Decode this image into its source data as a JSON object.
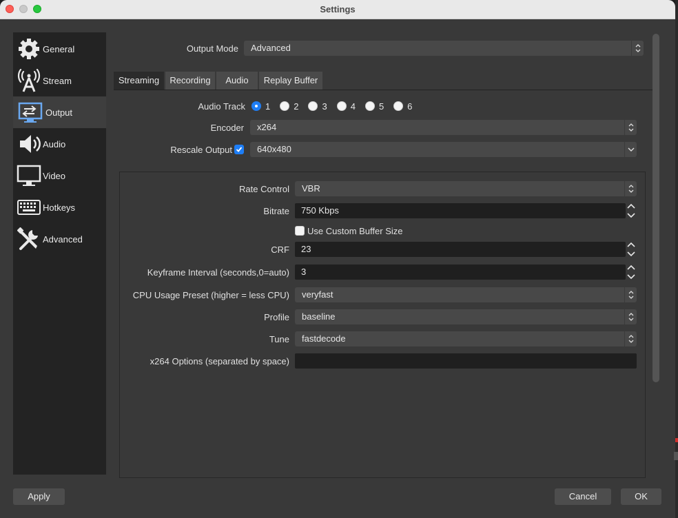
{
  "window": {
    "title": "Settings"
  },
  "sidebar": {
    "items": [
      {
        "label": "General",
        "icon": "gear-icon"
      },
      {
        "label": "Stream",
        "icon": "broadcast-antenna-icon"
      },
      {
        "label": "Output",
        "icon": "monitor-output-icon",
        "active": true
      },
      {
        "label": "Audio",
        "icon": "speaker-icon"
      },
      {
        "label": "Video",
        "icon": "monitor-icon"
      },
      {
        "label": "Hotkeys",
        "icon": "keyboard-icon"
      },
      {
        "label": "Advanced",
        "icon": "tools-icon"
      }
    ]
  },
  "output": {
    "mode_label": "Output Mode",
    "mode_value": "Advanced",
    "tabs": [
      "Streaming",
      "Recording",
      "Audio",
      "Replay Buffer"
    ],
    "active_tab": "Streaming",
    "audio_track_label": "Audio Track",
    "audio_tracks": [
      "1",
      "2",
      "3",
      "4",
      "5",
      "6"
    ],
    "audio_track_selected": "1",
    "encoder_label": "Encoder",
    "encoder_value": "x264",
    "rescale_label": "Rescale Output",
    "rescale_checked": true,
    "rescale_value": "640x480"
  },
  "encoder_settings": {
    "rate_control_label": "Rate Control",
    "rate_control_value": "VBR",
    "bitrate_label": "Bitrate",
    "bitrate_value": "750 Kbps",
    "custom_buffer_label": "Use Custom Buffer Size",
    "custom_buffer_checked": false,
    "crf_label": "CRF",
    "crf_value": "23",
    "keyframe_label": "Keyframe Interval (seconds,0=auto)",
    "keyframe_value": "3",
    "cpu_preset_label": "CPU Usage Preset (higher = less CPU)",
    "cpu_preset_value": "veryfast",
    "profile_label": "Profile",
    "profile_value": "baseline",
    "tune_label": "Tune",
    "tune_value": "fastdecode",
    "x264_options_label": "x264 Options (separated by space)",
    "x264_options_value": ""
  },
  "buttons": {
    "apply": "Apply",
    "cancel": "Cancel",
    "ok": "OK"
  },
  "colors": {
    "accent": "#1e7ef6",
    "window_bg": "#393939",
    "sidebar_bg": "#232323"
  }
}
